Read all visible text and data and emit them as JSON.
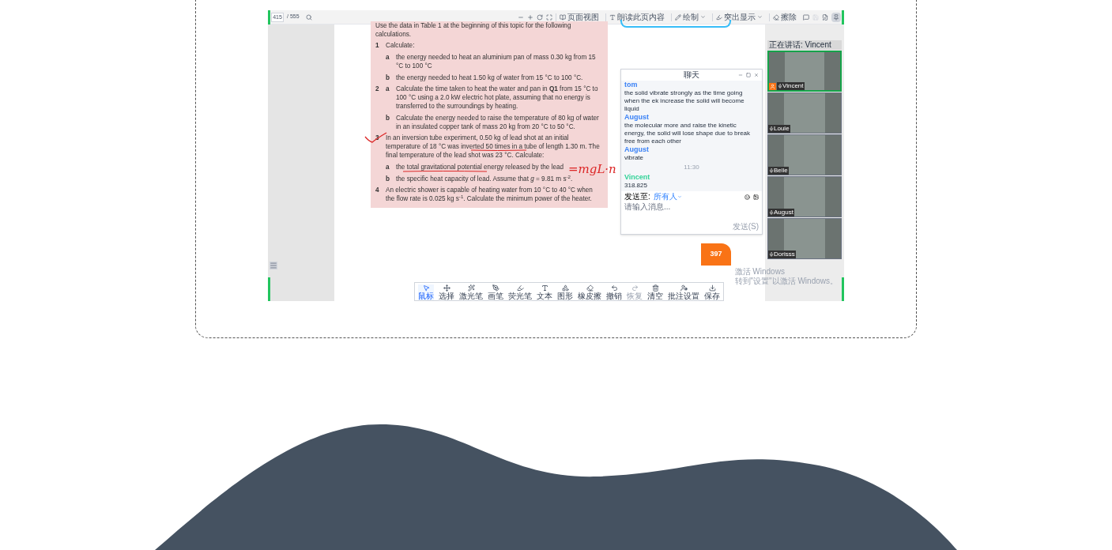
{
  "viewer": {
    "page_input": "415",
    "page_total": "/ 555",
    "tools": [
      {
        "label": "页面视图",
        "kind": "button"
      },
      {
        "label": "朗读此页内容",
        "kind": "button"
      },
      {
        "label": "绘制",
        "kind": "dropdown"
      },
      {
        "label": "突出显示",
        "kind": "dropdown"
      },
      {
        "label": "擦除",
        "kind": "button"
      }
    ],
    "pin_selected": true
  },
  "document": {
    "intro": "Use the data in Table 1 at the beginning of this topic for the following calculations.",
    "questions": [
      {
        "number": "1",
        "text": "Calculate:",
        "parts": [
          {
            "label": "a",
            "text": "the energy needed to heat an aluminium pan of mass 0.30 kg from 15 °C to 100 °C"
          },
          {
            "label": "b",
            "text": "the energy needed to heat 1.50 kg of water from 15 °C to 100 °C."
          }
        ]
      },
      {
        "number": "2",
        "parts": [
          {
            "label": "a",
            "text": "Calculate the time taken to heat the water and pan in **Q1** from 15 °C to 100 °C using a 2.0 kW electric hot plate, assuming that no energy is transferred to the surroundings by heating."
          },
          {
            "label": "b",
            "text": "Calculate the energy needed to raise the temperature of 80 kg of water in an insulated copper tank of mass 20 kg from 20 °C to 50 °C."
          }
        ]
      },
      {
        "number": "3",
        "text": "In an inversion tube experiment, 0.50 kg of lead shot at an initial temperature of 18 °C was inverted 50 times in a tube of length 1.30 m. The final temperature of the lead shot was 23 °C. Calculate:",
        "checked": true,
        "parts": [
          {
            "label": "a",
            "text": "the total gravitational potential energy released by the lead"
          },
          {
            "label": "b",
            "text": "the specific heat capacity of lead. Assume that *g* = 9.81 m s$^{-2}$."
          }
        ]
      },
      {
        "number": "4",
        "text": "An electric shower is capable of heating water from 10 °C to 40 °C when the flow rate is 0.025 kg s$^{-1}$. Calculate the minimum power of the heater."
      }
    ],
    "ink_note": "=mgL·n",
    "page_number": "397"
  },
  "chat": {
    "title": "聊天",
    "messages": [
      {
        "kind": "message",
        "sender": "tom",
        "color": "#3b82f6",
        "text": "the solid vibrate strongly as the time going when the ek increase the solid will become liquid"
      },
      {
        "kind": "message",
        "sender": "August",
        "color": "#3b82f6",
        "text": "the molecular more  and raise the kinetic energy, the solid will lose shape due to break free from each other"
      },
      {
        "kind": "message",
        "sender": "August",
        "color": "#3b82f6",
        "text": "vibrate"
      },
      {
        "kind": "time",
        "text": "11:30"
      },
      {
        "kind": "message",
        "sender": "Vincent",
        "color": "#34d399",
        "text": "318.825"
      }
    ],
    "send_to_label": "发送至:",
    "send_to_value": "所有人",
    "placeholder": "请输入消息...",
    "send_button": "发送(S)"
  },
  "video": {
    "speaking_label": "正在讲话: Vincent",
    "participants": [
      {
        "name": "Vincent",
        "speaking": true
      },
      {
        "name": "Louie",
        "speaking": false
      },
      {
        "name": "Belle",
        "speaking": false
      },
      {
        "name": "August",
        "speaking": false
      },
      {
        "name": "Dorisss",
        "speaking": false
      }
    ]
  },
  "annotation_toolbar": [
    {
      "label": "鼠标",
      "selected": true,
      "disabled": false
    },
    {
      "label": "选择",
      "selected": false,
      "disabled": false
    },
    {
      "label": "激光笔",
      "selected": false,
      "disabled": false
    },
    {
      "label": "画笔",
      "selected": false,
      "disabled": false
    },
    {
      "label": "荧光笔",
      "selected": false,
      "disabled": false
    },
    {
      "label": "文本",
      "selected": false,
      "disabled": false
    },
    {
      "label": "图形",
      "selected": false,
      "disabled": false
    },
    {
      "label": "橡皮擦",
      "selected": false,
      "disabled": false
    },
    {
      "label": "撤销",
      "selected": false,
      "disabled": false
    },
    {
      "label": "恢复",
      "selected": false,
      "disabled": true
    },
    {
      "label": "清空",
      "selected": false,
      "disabled": false
    },
    {
      "label": "批注设置",
      "selected": false,
      "disabled": false
    },
    {
      "label": "保存",
      "selected": false,
      "disabled": false
    }
  ],
  "os_notice": {
    "title": "激活 Windows",
    "text": "转到\"设置\"以激活 Windows。"
  }
}
